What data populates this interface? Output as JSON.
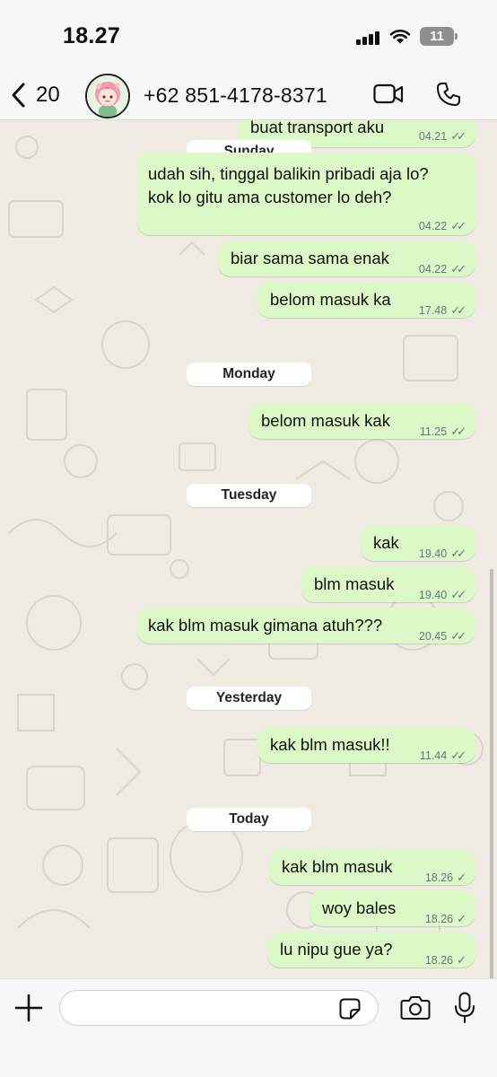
{
  "status": {
    "time": "18.27",
    "battery": "11"
  },
  "header": {
    "back_count": "20",
    "contact_name": "+62 851-4178-8371"
  },
  "dates": {
    "sunday": "Sunday",
    "monday": "Monday",
    "tuesday": "Tuesday",
    "yesterday": "Yesterday",
    "today": "Today"
  },
  "messages": [
    {
      "lines": [
        "buat transport aku"
      ],
      "time": "04.21",
      "status": "read"
    },
    {
      "lines": [
        "udah sih, tinggal balikin pribadi aja lo?",
        "kok lo gitu ama customer lo deh?"
      ],
      "time": "04.22",
      "status": "read"
    },
    {
      "lines": [
        "biar sama sama enak"
      ],
      "time": "04.22",
      "status": "read"
    },
    {
      "lines": [
        "belom masuk ka"
      ],
      "time": "17.48",
      "status": "read"
    },
    {
      "lines": [
        "belom masuk kak"
      ],
      "time": "11.25",
      "status": "read"
    },
    {
      "lines": [
        "kak"
      ],
      "time": "19.40",
      "status": "read"
    },
    {
      "lines": [
        "blm masuk"
      ],
      "time": "19.40",
      "status": "read"
    },
    {
      "lines": [
        "kak blm masuk gimana atuh???"
      ],
      "time": "20.45",
      "status": "read"
    },
    {
      "lines": [
        "kak blm masuk!!"
      ],
      "time": "11.44",
      "status": "read"
    },
    {
      "lines": [
        "kak blm masuk"
      ],
      "time": "18.26",
      "status": "sent"
    },
    {
      "lines": [
        "woy bales"
      ],
      "time": "18.26",
      "status": "sent"
    },
    {
      "lines": [
        "lu nipu gue ya?"
      ],
      "time": "18.26",
      "status": "sent"
    }
  ],
  "composer": {
    "placeholder": ""
  },
  "colors": {
    "bubble_out": "#dcf8c6",
    "chat_bg": "#efeae2",
    "bar_bg": "#f7f7f7",
    "meta": "#667781"
  },
  "icons": {
    "back": "chevron-left-icon",
    "video": "video-camera-icon",
    "call": "phone-icon",
    "plus": "plus-icon",
    "sticker": "sticker-icon",
    "camera": "camera-icon",
    "mic": "microphone-icon",
    "read": "double-check-icon",
    "sent": "single-check-icon"
  }
}
